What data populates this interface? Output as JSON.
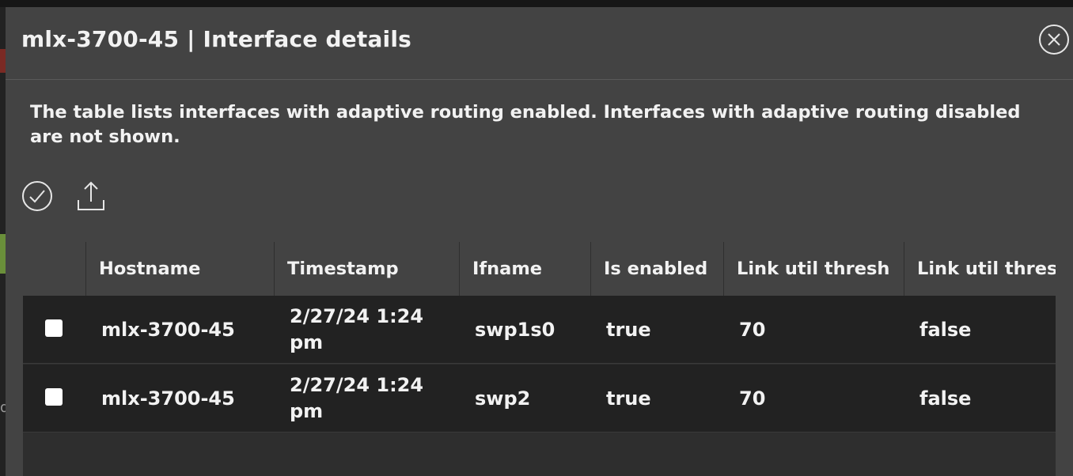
{
  "modal": {
    "title": "mlx-3700-45 | Interface details",
    "description": "The table lists interfaces with adaptive routing enabled. Interfaces with adaptive routing disabled are not shown."
  },
  "toolbar": {
    "select_icon": "check-circle-icon",
    "export_icon": "upload-icon"
  },
  "table": {
    "columns": [
      "Hostname",
      "Timestamp",
      "Ifname",
      "Is enabled",
      "Link util thresh",
      "Link util thres"
    ],
    "rows": [
      {
        "hostname": "mlx-3700-45",
        "timestamp": "2/27/24 1:24 pm",
        "ifname": "swp1s0",
        "is_enabled": "true",
        "link_util_thresh": "70",
        "link_util_thres2": "false"
      },
      {
        "hostname": "mlx-3700-45",
        "timestamp": "2/27/24 1:24 pm",
        "ifname": "swp2",
        "is_enabled": "true",
        "link_util_thresh": "70",
        "link_util_thres2": "false"
      }
    ]
  },
  "background": {
    "edge_glyph": "d"
  },
  "colors": {
    "modal_bg": "#434343",
    "row_bg": "#222222",
    "text": "#f2f2f2"
  }
}
